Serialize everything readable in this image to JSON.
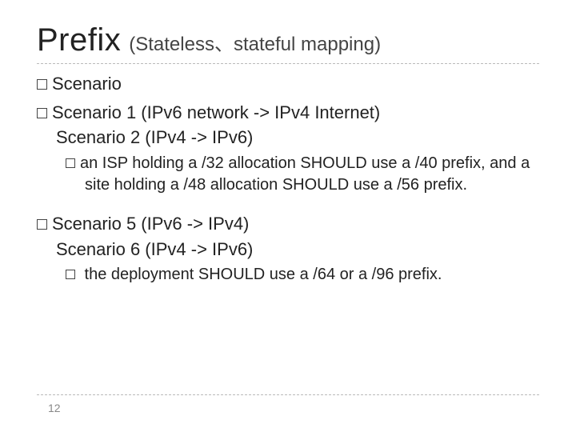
{
  "title": {
    "main": "Prefix",
    "sub": "(Stateless、stateful mapping)"
  },
  "bullets": {
    "b1": "Scenario",
    "b2_l1": "Scenario 1 (IPv6 network -> IPv4 Internet)",
    "b2_l2": "Scenario 2 (IPv4  ->  IPv6)",
    "b2_sub": "an ISP holding a /32 allocation SHOULD use a /40 prefix, and a site holding a /48 allocation SHOULD use a /56 prefix.",
    "b3_l1": "Scenario 5 (IPv6 -> IPv4)",
    "b3_l2": "Scenario 6 (IPv4 -> IPv6)",
    "b3_sub": " the deployment SHOULD use a /64 or a /96 prefix."
  },
  "page_number": "12"
}
